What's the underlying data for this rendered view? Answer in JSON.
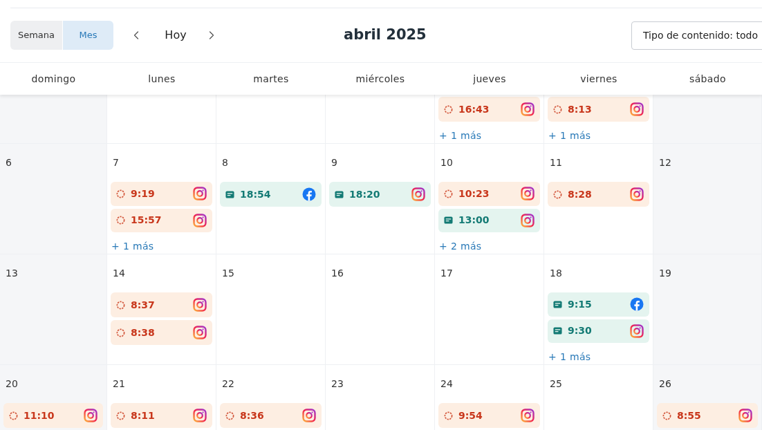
{
  "toolbar": {
    "views": [
      {
        "label": "Semana",
        "selected": false
      },
      {
        "label": "Mes",
        "selected": true
      }
    ],
    "today": "Hoy",
    "title": "abril 2025",
    "filter": "Tipo de contenido: todo"
  },
  "weekdays": [
    "domingo",
    "lunes",
    "martes",
    "miércoles",
    "jueves",
    "viernes",
    "sábado"
  ],
  "weeks": [
    {
      "kind": "partial",
      "days": [
        {
          "kind": "weekend"
        },
        {
          "kind": "weekday"
        },
        {
          "kind": "weekday"
        },
        {
          "kind": "weekday"
        },
        {
          "kind": "weekday",
          "events": [
            {
              "time": "16:43",
              "kind": "pending",
              "platform": {
                "kind": "instagram"
              }
            }
          ],
          "more": "+ 1 más"
        },
        {
          "kind": "weekday",
          "events": [
            {
              "time": "8:13",
              "kind": "pending",
              "platform": {
                "kind": "instagram"
              }
            }
          ],
          "more": "+ 1 más"
        },
        {
          "kind": "weekend"
        }
      ]
    },
    {
      "kind": "full",
      "days": [
        {
          "kind": "weekend",
          "number": "6"
        },
        {
          "kind": "weekday",
          "number": "7",
          "events": [
            {
              "time": "9:19",
              "kind": "pending",
              "platform": {
                "kind": "instagram"
              }
            },
            {
              "time": "15:57",
              "kind": "pending",
              "platform": {
                "kind": "instagram"
              }
            }
          ],
          "more": "+ 1 más"
        },
        {
          "kind": "weekday",
          "number": "8",
          "events": [
            {
              "time": "18:54",
              "kind": "post",
              "platform": {
                "kind": "facebook"
              }
            }
          ]
        },
        {
          "kind": "weekday",
          "number": "9",
          "events": [
            {
              "time": "18:20",
              "kind": "post",
              "platform": {
                "kind": "instagram"
              }
            }
          ]
        },
        {
          "kind": "weekday",
          "number": "10",
          "events": [
            {
              "time": "10:23",
              "kind": "pending",
              "platform": {
                "kind": "instagram"
              }
            },
            {
              "time": "13:00",
              "kind": "post",
              "platform": {
                "kind": "instagram"
              }
            }
          ],
          "more": "+ 2 más"
        },
        {
          "kind": "weekday",
          "number": "11",
          "events": [
            {
              "time": "8:28",
              "kind": "pending",
              "platform": {
                "kind": "instagram"
              }
            }
          ]
        },
        {
          "kind": "weekend",
          "number": "12"
        }
      ]
    },
    {
      "kind": "full",
      "days": [
        {
          "kind": "weekend",
          "number": "13"
        },
        {
          "kind": "weekday",
          "number": "14",
          "events": [
            {
              "time": "8:37",
              "kind": "pending",
              "platform": {
                "kind": "instagram"
              }
            },
            {
              "time": "8:38",
              "kind": "pending",
              "platform": {
                "kind": "instagram"
              }
            }
          ]
        },
        {
          "kind": "weekday",
          "number": "15"
        },
        {
          "kind": "weekday",
          "number": "16"
        },
        {
          "kind": "weekday",
          "number": "17"
        },
        {
          "kind": "weekday",
          "number": "18",
          "events": [
            {
              "time": "9:15",
              "kind": "post",
              "platform": {
                "kind": "facebook"
              }
            },
            {
              "time": "9:30",
              "kind": "post",
              "platform": {
                "kind": "instagram"
              }
            }
          ],
          "more": "+ 1 más"
        },
        {
          "kind": "weekend",
          "number": "19"
        }
      ]
    },
    {
      "kind": "full",
      "days": [
        {
          "kind": "weekend",
          "number": "20",
          "events": [
            {
              "time": "11:10",
              "kind": "pending",
              "platform": {
                "kind": "instagram"
              }
            }
          ]
        },
        {
          "kind": "weekday",
          "number": "21",
          "events": [
            {
              "time": "8:11",
              "kind": "pending",
              "platform": {
                "kind": "instagram"
              }
            }
          ]
        },
        {
          "kind": "weekday",
          "number": "22",
          "events": [
            {
              "time": "8:36",
              "kind": "pending",
              "platform": {
                "kind": "instagram"
              }
            }
          ]
        },
        {
          "kind": "weekday",
          "number": "23"
        },
        {
          "kind": "weekday",
          "number": "24",
          "events": [
            {
              "time": "9:54",
              "kind": "pending",
              "platform": {
                "kind": "instagram"
              }
            }
          ]
        },
        {
          "kind": "weekday",
          "number": "25"
        },
        {
          "kind": "weekend",
          "number": "26",
          "events": [
            {
              "time": "8:55",
              "kind": "pending",
              "platform": {
                "kind": "instagram"
              }
            }
          ]
        }
      ]
    }
  ]
}
